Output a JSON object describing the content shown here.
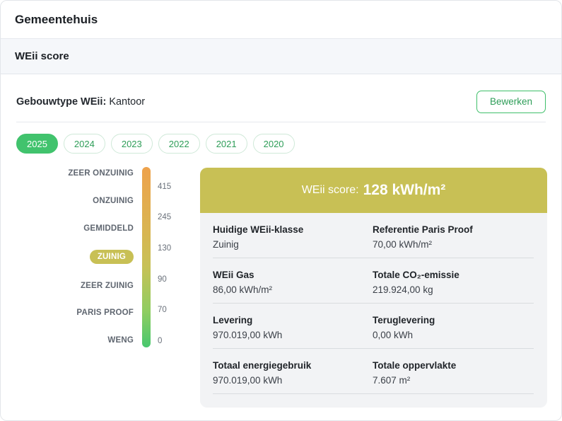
{
  "header": {
    "title": "Gemeentehuis"
  },
  "section": {
    "title": "WEii score"
  },
  "building_type": {
    "label": "Gebouwtype WEii:",
    "value": "Kantoor",
    "edit_label": "Bewerken"
  },
  "years": [
    "2025",
    "2024",
    "2023",
    "2022",
    "2021",
    "2020"
  ],
  "selected_year": "2025",
  "scale": {
    "classes": [
      "ZEER ONZUINIG",
      "ONZUINIG",
      "GEMIDDELD",
      "ZUINIG",
      "ZEER ZUINIG",
      "PARIS PROOF",
      "WENG"
    ],
    "current_class": "ZUINIG",
    "ticks": [
      "415",
      "245",
      "130",
      "90",
      "70",
      "0"
    ]
  },
  "score": {
    "label": "WEii score:",
    "value": "128 kWh/m²",
    "color": "#c8c055",
    "rows": [
      [
        {
          "label": "Huidige WEii-klasse",
          "value": "Zuinig"
        },
        {
          "label": "Referentie Paris Proof",
          "value": "70,00 kWh/m²"
        }
      ],
      [
        {
          "label": "WEii Gas",
          "value": "86,00 kWh/m²"
        },
        {
          "label": "Totale CO₂-emissie",
          "value": "219.924,00 kg"
        }
      ],
      [
        {
          "label": "Levering",
          "value": "970.019,00 kWh"
        },
        {
          "label": "Teruglevering",
          "value": "0,00 kWh"
        }
      ],
      [
        {
          "label": "Totaal energiegebruik",
          "value": "970.019,00 kWh"
        },
        {
          "label": "Totale oppervlakte",
          "value": "7.607 m²"
        }
      ]
    ]
  },
  "colors": {
    "accent": "#41c36d",
    "score": "#c8c055"
  }
}
